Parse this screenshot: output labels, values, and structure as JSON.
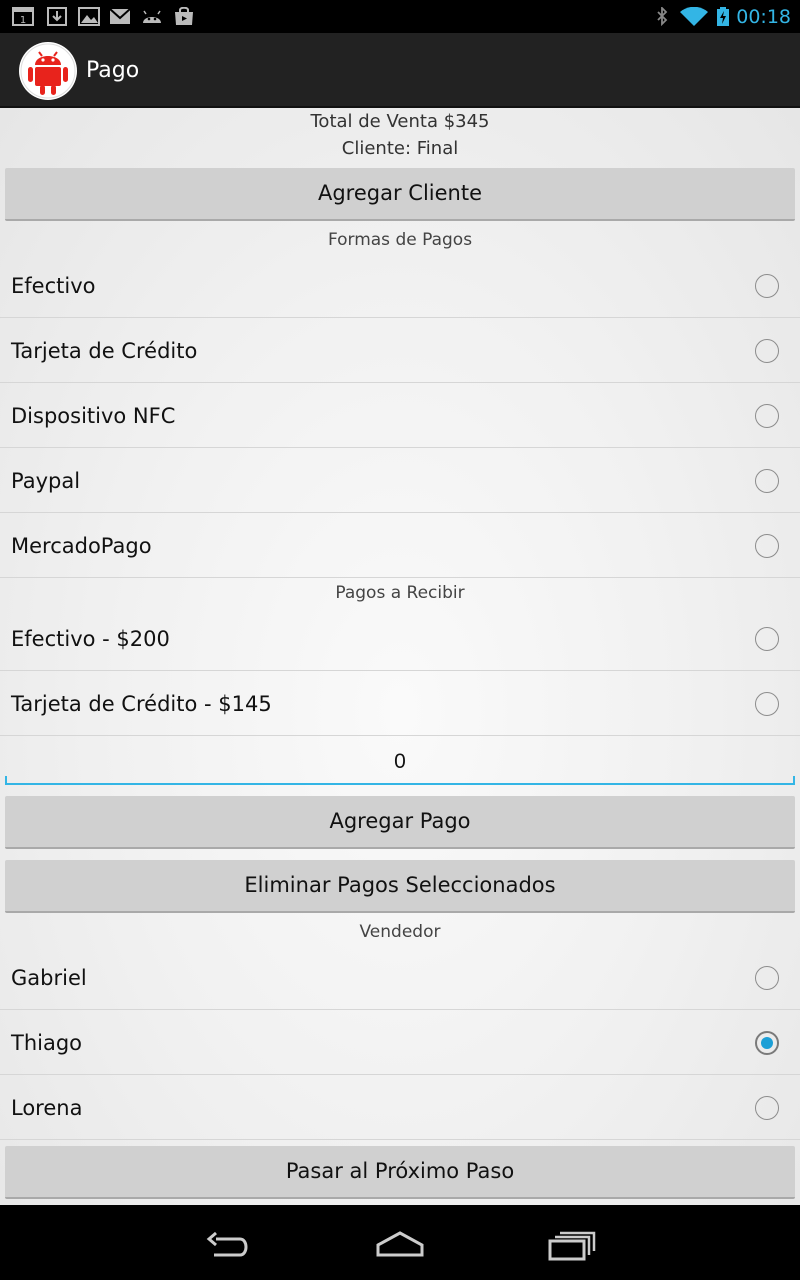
{
  "status_bar": {
    "time": "00:18",
    "left_icons": [
      "calendar-icon",
      "download-icon",
      "image-icon",
      "mail-icon",
      "android-icon",
      "shopping-bag-icon"
    ],
    "right_icons": [
      "bluetooth-icon",
      "wifi-icon",
      "battery-charging-icon"
    ],
    "accent_color": "#33b5e5"
  },
  "action_bar": {
    "title": "Pago",
    "logo": "android-robot-icon",
    "logo_color": "#e8231c"
  },
  "summary": {
    "total": "Total de Venta $345",
    "client": "Cliente: Final"
  },
  "buttons": {
    "add_client": "Agregar Cliente",
    "add_payment": "Agregar Pago",
    "delete_selected": "Eliminar Pagos Seleccionados",
    "next_step": "Pasar al Próximo Paso"
  },
  "payment_methods": {
    "header": "Formas de Pagos",
    "items": [
      {
        "label": "Efectivo",
        "selected": false
      },
      {
        "label": "Tarjeta de Crédito",
        "selected": false
      },
      {
        "label": "Dispositivo NFC",
        "selected": false
      },
      {
        "label": "Paypal",
        "selected": false
      },
      {
        "label": "MercadoPago",
        "selected": false
      }
    ]
  },
  "payments_to_receive": {
    "header": "Pagos a Recibir",
    "items": [
      {
        "label": "Efectivo - $200",
        "selected": false
      },
      {
        "label": "Tarjeta de Crédito - $145",
        "selected": false
      }
    ]
  },
  "amount_input": {
    "value": "0"
  },
  "sellers": {
    "header": "Vendedor",
    "items": [
      {
        "label": "Gabriel",
        "selected": false
      },
      {
        "label": "Thiago",
        "selected": true
      },
      {
        "label": "Lorena",
        "selected": false
      }
    ]
  },
  "nav_bar": {
    "buttons": [
      "back-icon",
      "home-icon",
      "recent-apps-icon"
    ]
  }
}
